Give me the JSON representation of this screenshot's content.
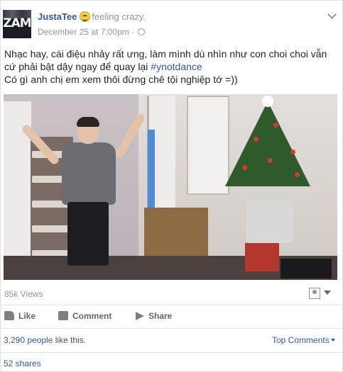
{
  "post": {
    "author": "JustaTee",
    "feeling_emoji": "crazy-face-emoji",
    "feeling": "feeling crazy.",
    "timestamp": "December 25 at 7:00pm",
    "meta_separator": "·",
    "privacy_icon": "globe-icon",
    "menu_icon": "chevron-down-icon",
    "avatar_text": "ZAM",
    "text_line1": "Nhạc hay, cái điệu nhảy rất ưng, làm mình dù nhìn như con choi choi vẫn cứ phải bật dậy ngay để quay lại ",
    "hashtag": "#ynotdance",
    "text_line2": "Có gì anh chị em xem thôi đừng chê tội nghiệp tớ =))"
  },
  "video": {
    "views": "85k Views",
    "save_icon": "save-icon"
  },
  "actions": {
    "like": "Like",
    "comment": "Comment",
    "share": "Share",
    "like_icon": "thumbs-up-icon",
    "comment_icon": "comment-bubble-icon",
    "share_icon": "share-arrow-icon"
  },
  "stats": {
    "likes_count": "3,290 people",
    "likes_suffix": " like this.",
    "top_comments": "Top Comments",
    "shares": "52 shares"
  },
  "colors": {
    "link": "#365899",
    "muted": "#90949c",
    "text": "#1d2129",
    "action": "#606770"
  }
}
